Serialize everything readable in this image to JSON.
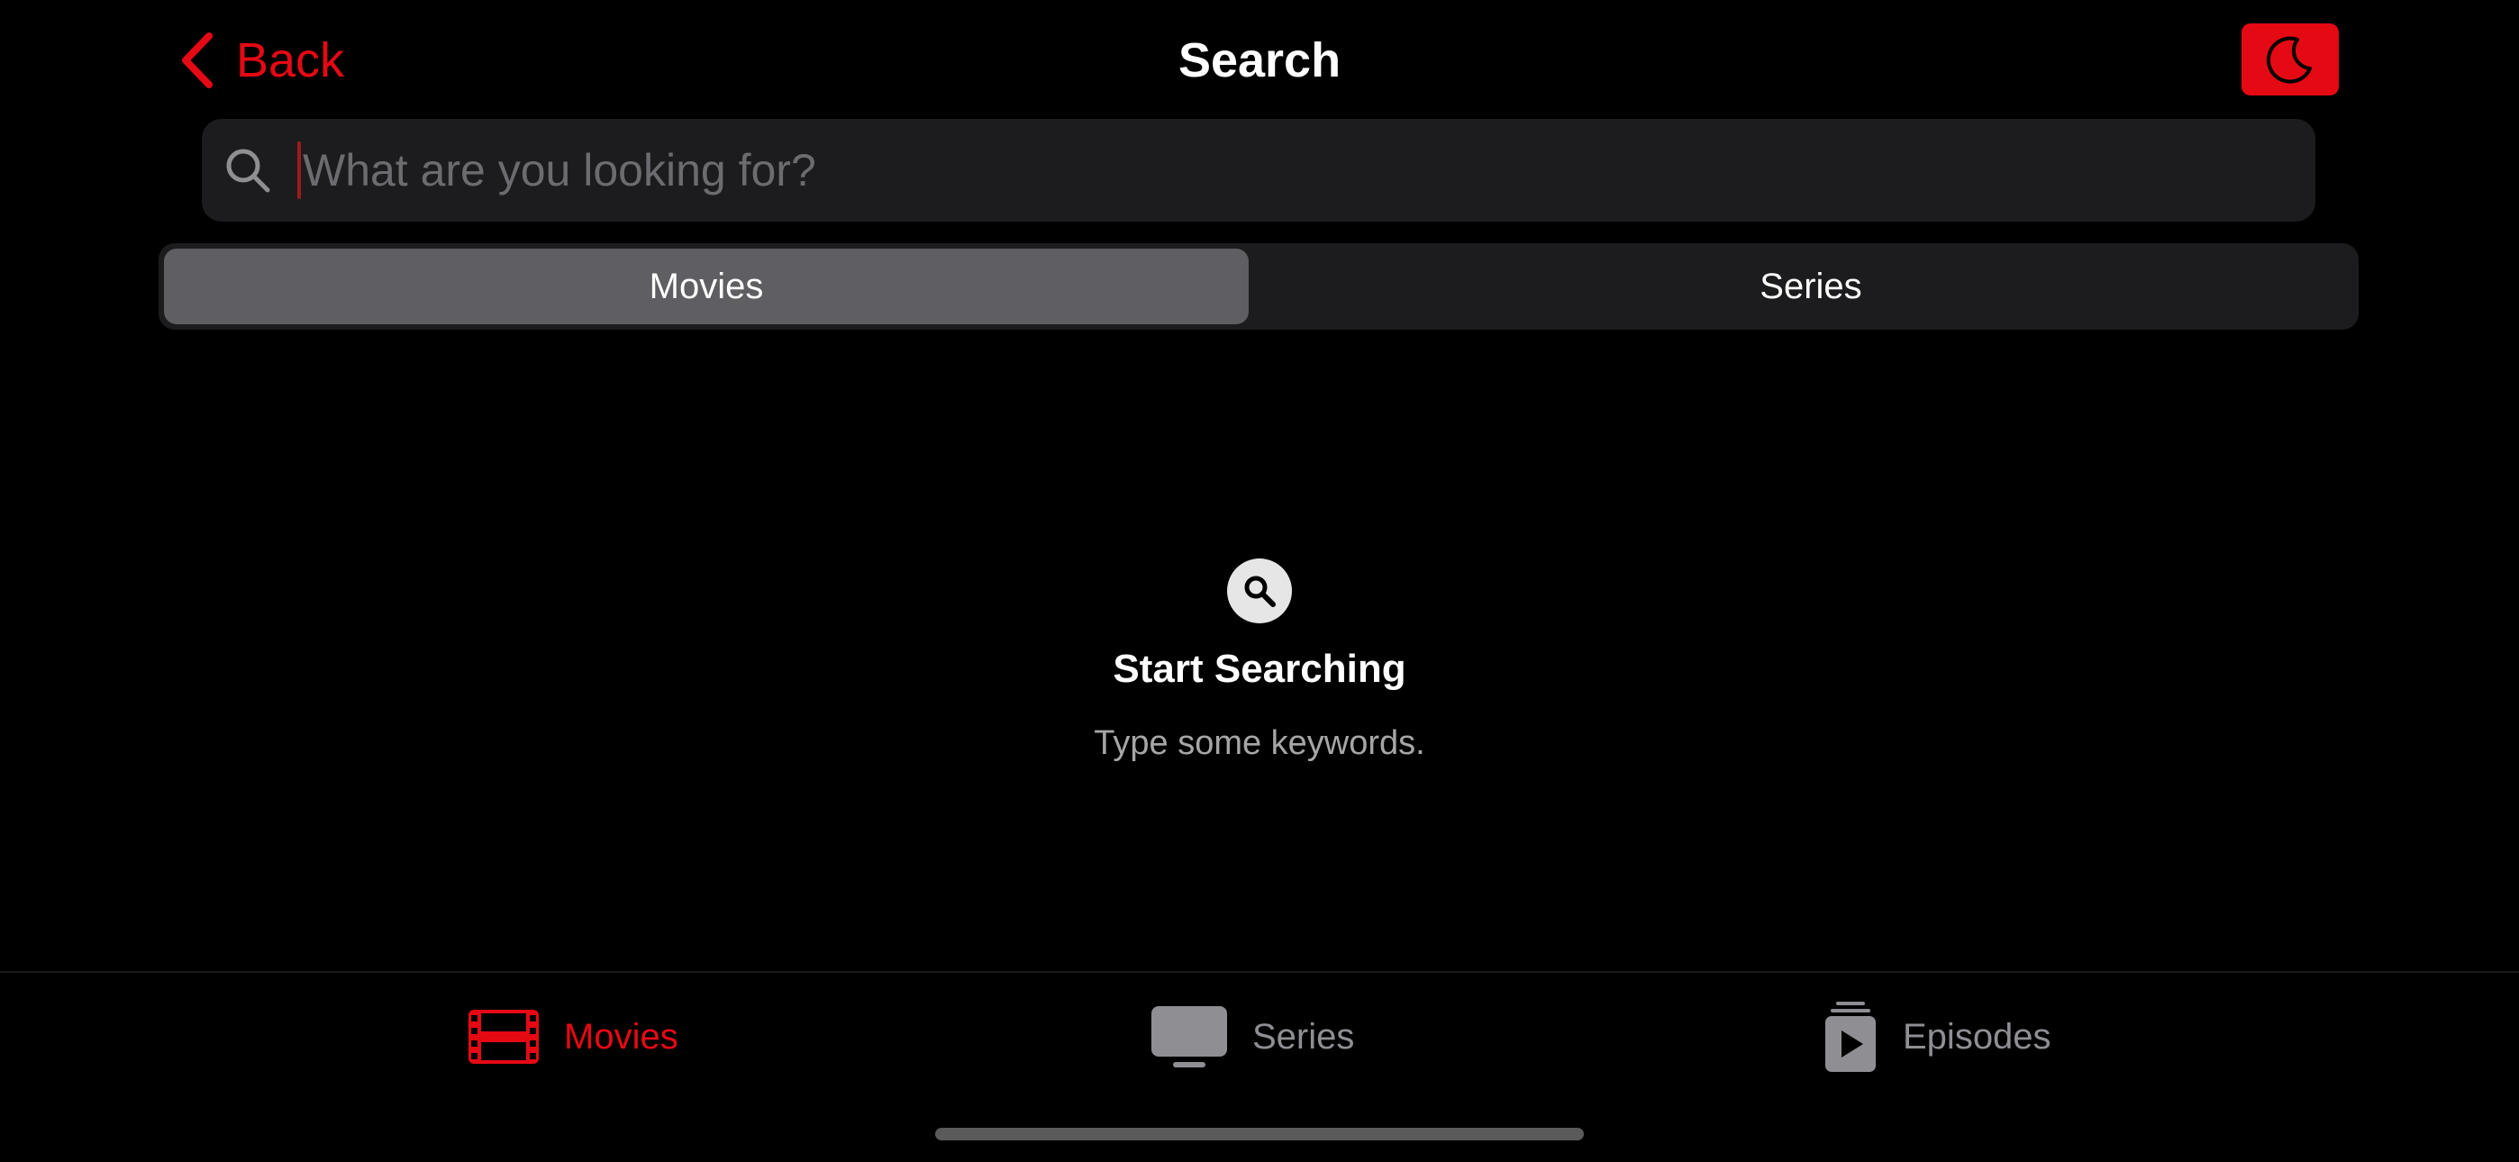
{
  "header": {
    "back_label": "Back",
    "title": "Search",
    "theme_toggle_icon": "moon-icon"
  },
  "search": {
    "placeholder": "What are you looking for?",
    "value": ""
  },
  "segments": {
    "items": [
      {
        "label": "Movies",
        "selected": true
      },
      {
        "label": "Series",
        "selected": false
      }
    ]
  },
  "empty_state": {
    "icon": "magnifier-icon",
    "title": "Start Searching",
    "subtitle": "Type some keywords."
  },
  "tabbar": {
    "items": [
      {
        "label": "Movies",
        "icon": "film-icon",
        "active": true
      },
      {
        "label": "Series",
        "icon": "tv-icon",
        "active": false
      },
      {
        "label": "Episodes",
        "icon": "episodes-icon",
        "active": false
      }
    ]
  },
  "colors": {
    "accent": "#e50914",
    "background": "#000000",
    "field_bg": "#1c1c1e",
    "segment_selected": "#5e5e63",
    "inactive": "#8e8e93"
  }
}
